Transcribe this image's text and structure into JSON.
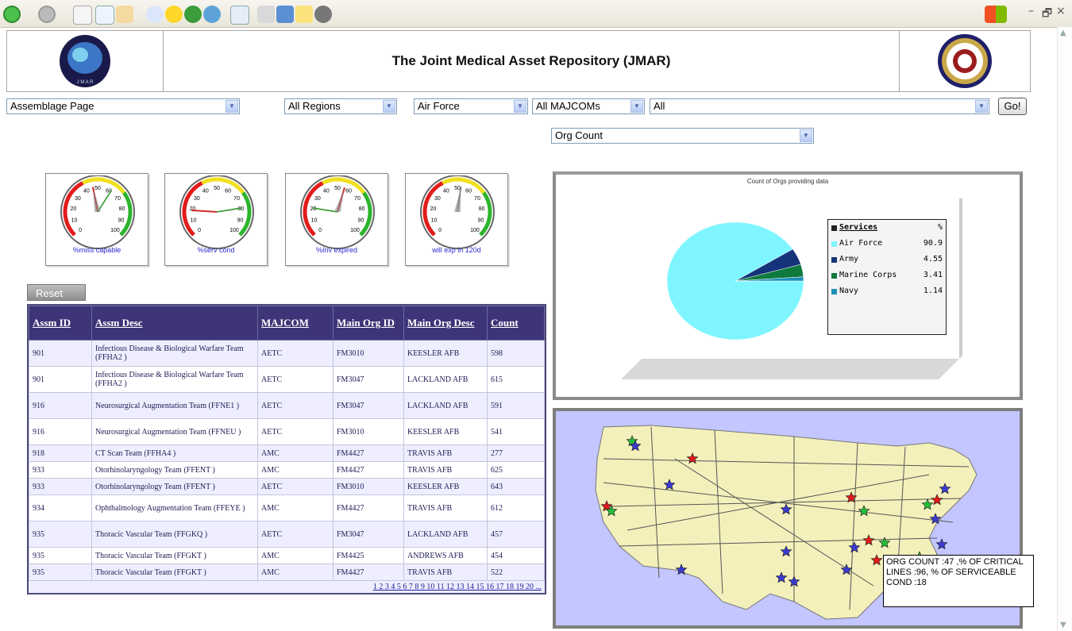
{
  "browser": {
    "toolbar_icons": [
      "back-icon",
      "forward-icon",
      "stop-icon",
      "refresh-icon",
      "home-icon",
      "search-icon",
      "favorites-icon",
      "media-icon",
      "history-icon",
      "mail-icon",
      "print-icon",
      "edit-icon",
      "discuss-icon",
      "messenger-icon"
    ],
    "window_controls": [
      "–",
      "🗗",
      "×"
    ]
  },
  "header": {
    "title": "The Joint Medical Asset Repository (JMAR)",
    "left_logo_text": "J M A R"
  },
  "filters": {
    "page": "Assemblage Page",
    "region": "All Regions",
    "service": "Air Force",
    "majcom": "All MAJCOMs",
    "org": "All",
    "go": "Go!",
    "metric": "Org Count"
  },
  "gauges": [
    {
      "label": "%miss capable",
      "ticks": [
        "0",
        "10",
        "20",
        "30",
        "40",
        "50",
        "60",
        "70",
        "80",
        "90",
        "100"
      ],
      "needles": [
        46,
        62
      ]
    },
    {
      "label": "%serv cond",
      "ticks": [
        "0",
        "10",
        "20",
        "30",
        "40",
        "50",
        "60",
        "70",
        "80",
        "90",
        "100"
      ],
      "needles": [
        18,
        80
      ]
    },
    {
      "label": "%Inv expired",
      "ticks": [
        "0",
        "10",
        "20",
        "30",
        "40",
        "50",
        "60",
        "70",
        "80",
        "90",
        "100"
      ],
      "needles": [
        56,
        20
      ]
    },
    {
      "label": "will exp in 120d",
      "ticks": [
        "0",
        "10",
        "20",
        "30",
        "40",
        "50",
        "60",
        "70",
        "80",
        "90",
        "100"
      ],
      "needles": [
        53
      ]
    }
  ],
  "reset_label": "Reset",
  "table": {
    "headers": [
      "Assm ID",
      "Assm Desc",
      "MAJCOM",
      "Main Org ID",
      "Main Org Desc",
      "Count"
    ],
    "rows": [
      [
        "901",
        "Infectious Disease & Biological Warfare Team (FFHA2 )",
        "AETC",
        "FM3010",
        "KEESLER AFB",
        "598"
      ],
      [
        "901",
        "Infectious Disease & Biological Warfare Team (FFHA2 )",
        "AETC",
        "FM3047",
        "LACKLAND AFB",
        "615"
      ],
      [
        "916",
        "Neurosurgical Augmentation Team (FFNE1 )",
        "AETC",
        "FM3047",
        "LACKLAND AFB",
        "591"
      ],
      [
        "916",
        "Neurosurgical Augmentation Team (FFNEU )",
        "AETC",
        "FM3010",
        "KEESLER AFB",
        "541"
      ],
      [
        "918",
        "CT Scan Team (FFHA4 )",
        "AMC",
        "FM4427",
        "TRAVIS AFB",
        "277"
      ],
      [
        "933",
        "Otorhinolaryngology Team (FFENT )",
        "AMC",
        "FM4427",
        "TRAVIS AFB",
        "625"
      ],
      [
        "933",
        "Otorhinolaryngology Team (FFENT )",
        "AETC",
        "FM3010",
        "KEESLER AFB",
        "643"
      ],
      [
        "934",
        "Ophthalmology Augmentation Team (FFEYE )",
        "AMC",
        "FM4427",
        "TRAVIS AFB",
        "612"
      ],
      [
        "935",
        "Thoracic Vascular Team (FFGKQ )",
        "AETC",
        "FM3047",
        "LACKLAND AFB",
        "457"
      ],
      [
        "935",
        "Thoracic Vascular Team (FFGKT )",
        "AMC",
        "FM4425",
        "ANDREWS AFB",
        "454"
      ],
      [
        "935",
        "Thoracic Vascular Team (FFGKT )",
        "AMC",
        "FM4427",
        "TRAVIS AFB",
        "522"
      ]
    ],
    "pager": "1 2 3 4 5 6 7 8 9 10 11 12 13 14 15 16 17 18 19 20 ..."
  },
  "chart_data": {
    "type": "pie",
    "title": "Count of Orgs providing data",
    "legend_header": [
      "Services",
      "%"
    ],
    "categories": [
      "Air Force",
      "Army",
      "Marine Corps",
      "Navy"
    ],
    "values": [
      90.9,
      4.55,
      3.41,
      1.14
    ],
    "colors": [
      "#7ff6ff",
      "#14337a",
      "#0f7a3e",
      "#1d8fb8"
    ],
    "legend_position": "right"
  },
  "map": {
    "tooltip": "ORG COUNT :47 ,% OF CRITICAL LINES :96, % OF SERVICEABLE COND :18"
  }
}
